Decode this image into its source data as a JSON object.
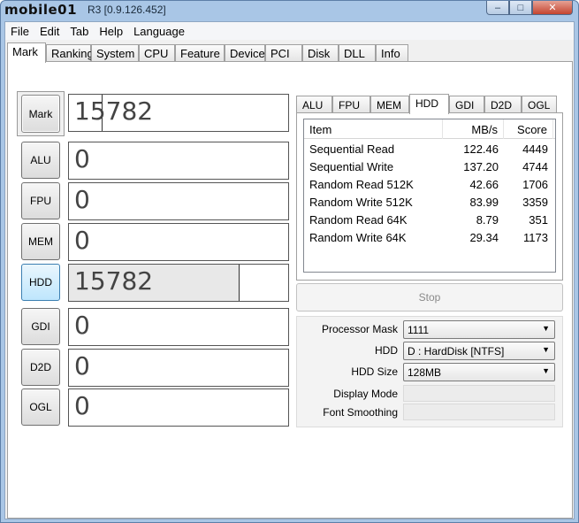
{
  "window": {
    "logo_text": "mobile01",
    "title": "R3 [0.9.126.452]"
  },
  "window_controls": {
    "minimize": "–",
    "maximize": "□",
    "close": "✕"
  },
  "menu": [
    "File",
    "Edit",
    "Tab",
    "Help",
    "Language"
  ],
  "main_tabs": [
    "Mark",
    "Ranking",
    "System",
    "CPU",
    "Feature",
    "Device",
    "PCI",
    "Disk",
    "DLL",
    "Info"
  ],
  "main_tab_active": "Mark",
  "mark": {
    "label": "Mark",
    "score": "15782"
  },
  "benchmarks": [
    {
      "label": "ALU",
      "score": "0"
    },
    {
      "label": "FPU",
      "score": "0"
    },
    {
      "label": "MEM",
      "score": "0"
    },
    {
      "label": "HDD",
      "score": "15782",
      "progress": 0.78
    },
    {
      "label": "GDI",
      "score": "0"
    },
    {
      "label": "D2D",
      "score": "0"
    },
    {
      "label": "OGL",
      "score": "0"
    }
  ],
  "sub_tabs": [
    "ALU",
    "FPU",
    "MEM",
    "HDD",
    "GDI",
    "D2D",
    "OGL"
  ],
  "sub_tab_active": "HDD",
  "results_table": {
    "columns": [
      "Item",
      "MB/s",
      "Score"
    ],
    "rows": [
      [
        "Sequential Read",
        "122.46",
        "4449"
      ],
      [
        "Sequential Write",
        "137.20",
        "4744"
      ],
      [
        "Random Read 512K",
        "42.66",
        "1706"
      ],
      [
        "Random Write 512K",
        "83.99",
        "3359"
      ],
      [
        "Random Read 64K",
        "8.79",
        "351"
      ],
      [
        "Random Write 64K",
        "29.34",
        "1173"
      ]
    ]
  },
  "stop_label": "Stop",
  "options": {
    "processor_mask": {
      "label": "Processor Mask",
      "value": "1111"
    },
    "hdd": {
      "label": "HDD",
      "value": "D : HardDisk [NTFS]"
    },
    "hdd_size": {
      "label": "HDD Size",
      "value": "128MB"
    },
    "display_mode": {
      "label": "Display Mode",
      "value": ""
    },
    "font_smoothing": {
      "label": "Font Smoothing",
      "value": ""
    }
  },
  "colors": {
    "title_bar": "#a9c6e6",
    "close_button": "#c4442f",
    "focused_button": "#bee6fd"
  }
}
